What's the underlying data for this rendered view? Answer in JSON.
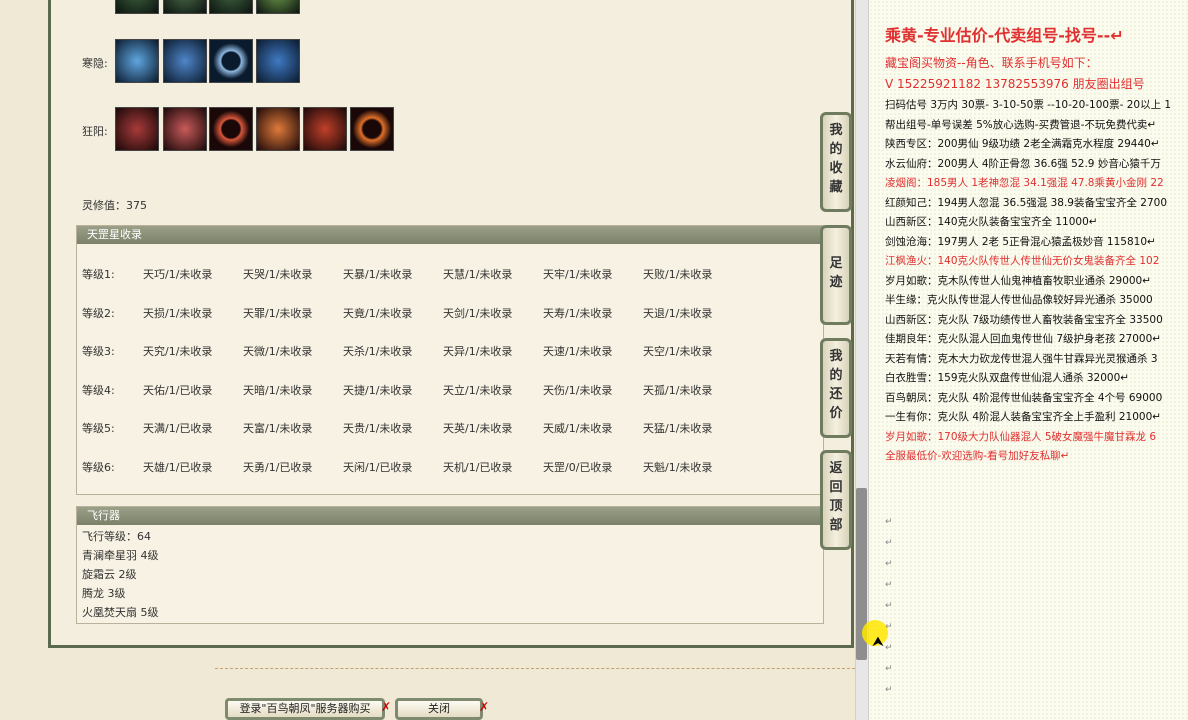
{
  "left": {
    "hanyin_label": "寒隐:",
    "kuangyang_label": "狂阳:",
    "lingxiu": "灵修值：375",
    "tiangang": {
      "title": "天罡星收录",
      "rows": [
        {
          "level": "等级1:",
          "items": [
            "天巧/1/未收录",
            "天哭/1/未收录",
            "天暴/1/未收录",
            "天慧/1/未收录",
            "天牢/1/未收录",
            "天败/1/未收录"
          ]
        },
        {
          "level": "等级2:",
          "items": [
            "天损/1/未收录",
            "天罪/1/未收录",
            "天竟/1/未收录",
            "天剑/1/未收录",
            "天寿/1/未收录",
            "天退/1/未收录"
          ]
        },
        {
          "level": "等级3:",
          "items": [
            "天究/1/未收录",
            "天微/1/未收录",
            "天杀/1/未收录",
            "天异/1/未收录",
            "天速/1/未收录",
            "天空/1/未收录"
          ]
        },
        {
          "level": "等级4:",
          "items": [
            "天佑/1/已收录",
            "天暗/1/未收录",
            "天捷/1/未收录",
            "天立/1/未收录",
            "天伤/1/未收录",
            "天孤/1/未收录"
          ]
        },
        {
          "level": "等级5:",
          "items": [
            "天满/1/已收录",
            "天富/1/未收录",
            "天贵/1/未收录",
            "天英/1/未收录",
            "天威/1/未收录",
            "天猛/1/未收录"
          ]
        },
        {
          "level": "等级6:",
          "items": [
            "天雄/1/已收录",
            "天勇/1/已收录",
            "天闲/1/已收录",
            "天机/1/已收录",
            "天罡/0/已收录",
            "天魁/1/未收录"
          ]
        }
      ]
    },
    "feixing": {
      "title": "飞行器",
      "level": "飞行等级：64",
      "items": [
        "青澜牵星羽   4级",
        "旋霜云   2级",
        "腾龙   3级",
        "火凰焚天扇   5级"
      ]
    },
    "buttons": {
      "login": "登录\"百鸟朝凤\"服务器购买",
      "close": "关闭",
      "x": "✗"
    }
  },
  "side_buttons": [
    {
      "label": "我的收藏",
      "chars": [
        "我",
        "的",
        "收",
        "藏"
      ]
    },
    {
      "label": "足迹",
      "chars": [
        "足",
        "迹"
      ]
    },
    {
      "label": "我的还价",
      "chars": [
        "我",
        "的",
        "还",
        "价"
      ]
    },
    {
      "label": "返回顶部",
      "chars": [
        "返",
        "回",
        "顶",
        "部"
      ]
    }
  ],
  "right": {
    "title": "乘黄-专业估价-代卖组号-找号--↵",
    "line2": "藏宝阁买物资--角色、联系手机号如下：",
    "line3": "V 15225921182   13782553976 朋友圈出组号",
    "lines": [
      {
        "text": "扫码估号 3万内 30票- 3-10-50票 --10-20-100票- 20以上 1",
        "red": false
      },
      {
        "text": "帮出组号-单号误差 5%放心选购-买费管退-不玩免费代卖↵",
        "red": false
      },
      {
        "text": "陕西专区：200男仙 9级功绩 2老全满霜克水程度 29440↵",
        "red": false
      },
      {
        "text": "水云仙府：200男人 4阶正骨忽 36.6强 52.9 妙音心猿千万",
        "red": false
      },
      {
        "text": "凌烟阁：185男人 1老神忽混 34.1强混 47.8乘黄小金刚 22",
        "red": true
      },
      {
        "text": "红颜知己：194男人忽混 36.5强混 38.9装备宝宝齐全 2700",
        "red": false
      },
      {
        "text": "山西新区：140克火队装备宝宝齐全 11000↵",
        "red": false
      },
      {
        "text": "剑蚀沧海：197男人 2老 5正骨混心猿孟极妙音 115810↵",
        "red": false
      },
      {
        "text": "江枫渔火：140克火队传世人传世仙无价女鬼装备齐全 102",
        "red": true
      },
      {
        "text": "岁月如歌：克木队传世人仙鬼神植畜牧职业通杀 29000↵",
        "red": false
      },
      {
        "text": "半生缘：克火队传世混人传世仙品像较好异光通杀 35000",
        "red": false
      },
      {
        "text": "山西新区：克火队 7级功绩传世人畜牧装备宝宝齐全 33500",
        "red": false
      },
      {
        "text": "佳期良年：克火队混人回血鬼传世仙 7级护身老孩 27000↵",
        "red": false
      },
      {
        "text": "天若有情：克木大力砍龙传世混人强牛甘霖异光灵猴通杀 3",
        "red": false
      },
      {
        "text": "白衣胜雪：159克火队双盘传世仙混人通杀 32000↵",
        "red": false
      },
      {
        "text": "百鸟朝凤：克火队 4阶混传世仙装备宝宝齐全 4个号 69000",
        "red": false
      },
      {
        "text": "一生有你：克火队 4阶混人装备宝宝齐全上手盈利 21000↵",
        "red": false
      },
      {
        "text": "岁月如歌：170级大力队仙器混人 5破女魔强牛魔甘霖龙 6",
        "red": true
      },
      {
        "text": "全服最低价-欢迎选购-看号加好友私聊↵",
        "red": true
      }
    ],
    "return_mark": "↵"
  }
}
